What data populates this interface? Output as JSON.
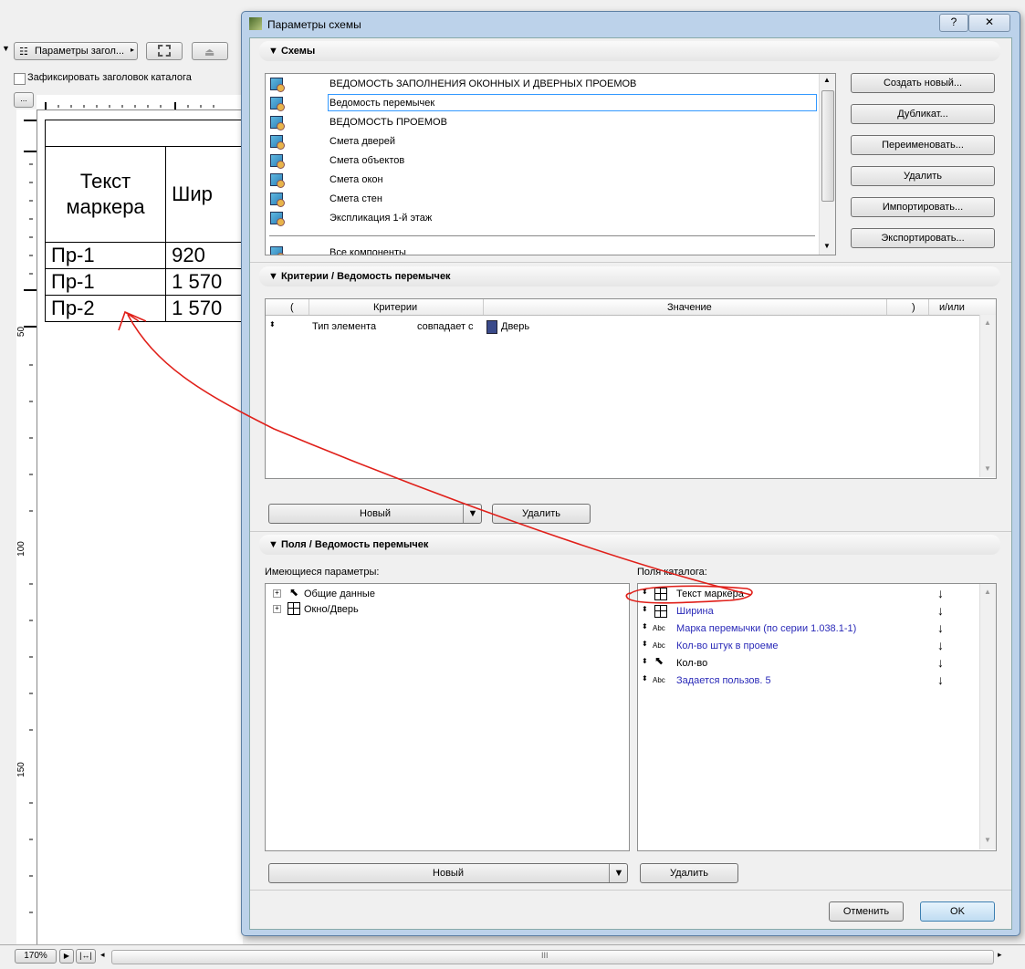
{
  "toolbar": {
    "header_params_label": "Параметры загол...",
    "freeze_header_label": "Зафиксировать заголовок каталога",
    "dots_label": "..."
  },
  "sheet": {
    "header": [
      "Текст маркера",
      "Шир"
    ],
    "rows": [
      [
        "Пр-1",
        "920"
      ],
      [
        "Пр-1",
        "1 570"
      ],
      [
        "Пр-2",
        "1 570"
      ]
    ],
    "ruler_v": [
      "50",
      "100",
      "150"
    ]
  },
  "statusbar": {
    "zoom": "170%",
    "scroll_mark": "III"
  },
  "dialog": {
    "title": "Параметры схемы",
    "help_button": "?",
    "schemes": {
      "section_title": "Схемы",
      "items": [
        "ВЕДОМОСТЬ ЗАПОЛНЕНИЯ ОКОННЫХ И ДВЕРНЫХ ПРОЕМОВ",
        "Ведомость перемычек",
        "ВЕДОМОСТЬ ПРОЕМОВ",
        "Смета дверей",
        "Смета объектов",
        "Смета окон",
        "Смета стен",
        "Экспликация 1-й этаж",
        "Все компоненты"
      ],
      "selected_index": 1,
      "buttons": [
        "Создать новый...",
        "Дубликат...",
        "Переименовать...",
        "Удалить",
        "Импортировать...",
        "Экспортировать..."
      ]
    },
    "criteria": {
      "section_title": "Критерии /  Ведомость перемычек",
      "columns": [
        "(",
        "Критерии",
        "Значение",
        ")",
        "и/или"
      ],
      "rows": [
        {
          "criterion": "Тип элемента",
          "operator": "совпадает с",
          "value": "Дверь"
        }
      ],
      "new_button": "Новый",
      "delete_button": "Удалить"
    },
    "fields": {
      "section_title": "Поля /  Ведомость перемычек",
      "available_label": "Имеющиеся параметры:",
      "catalog_label": "Поля каталога:",
      "available": [
        {
          "label": "Общие данные"
        },
        {
          "label": "Окно/Дверь"
        }
      ],
      "catalog": [
        {
          "label": "Текст маркера",
          "badge": ""
        },
        {
          "label": "Ширина",
          "badge": ""
        },
        {
          "label": "Марка перемычки (по серии 1.038.1-1)",
          "badge": "Abc"
        },
        {
          "label": "Кол-во штук в проеме",
          "badge": "Abc"
        },
        {
          "label": "Кол-во",
          "badge": ""
        },
        {
          "label": "Задается пользов. 5",
          "badge": "Abc"
        }
      ],
      "new_button": "Новый",
      "delete_button": "Удалить"
    },
    "cancel_button": "Отменить",
    "ok_button": "OK"
  },
  "colors": {
    "accent_selection": "#3399ff",
    "annotation_red": "#e0201a",
    "link_blue": "#2a2ab8"
  }
}
